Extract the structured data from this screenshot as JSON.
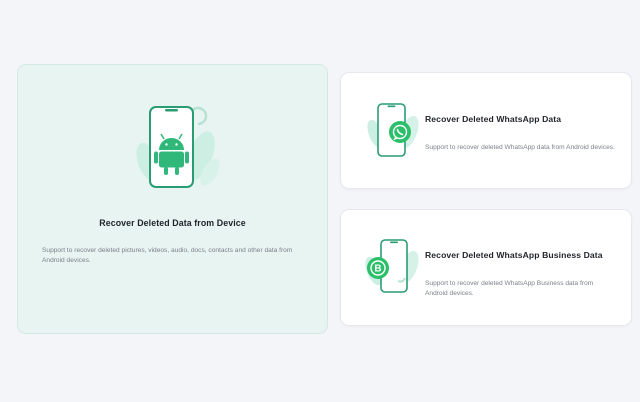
{
  "options": [
    {
      "title": "Recover Deleted Data from Device",
      "description": "Support to recover deleted pictures, videos, audio, docs, contacts and other data from Android devices.",
      "icon": "android-phone-icon",
      "accent": "#2fb87a"
    },
    {
      "title": "Recover Deleted WhatsApp Data",
      "description": "Support to recover deleted WhatsApp data from Android devices.",
      "icon": "whatsapp-phone-icon",
      "accent": "#2bbf6a"
    },
    {
      "title": "Recover Deleted WhatsApp Business Data",
      "description": "Support to recover deleted WhatsApp Business data from Android devices.",
      "icon": "whatsapp-business-phone-icon",
      "accent": "#2bbf6a"
    }
  ],
  "selected_index": 0,
  "colors": {
    "background": "#f4f5f8",
    "selected_card": "#e8f4f1",
    "card": "#ffffff",
    "leaf": "#cdeee2",
    "phone_outline": "#2a9c72"
  }
}
